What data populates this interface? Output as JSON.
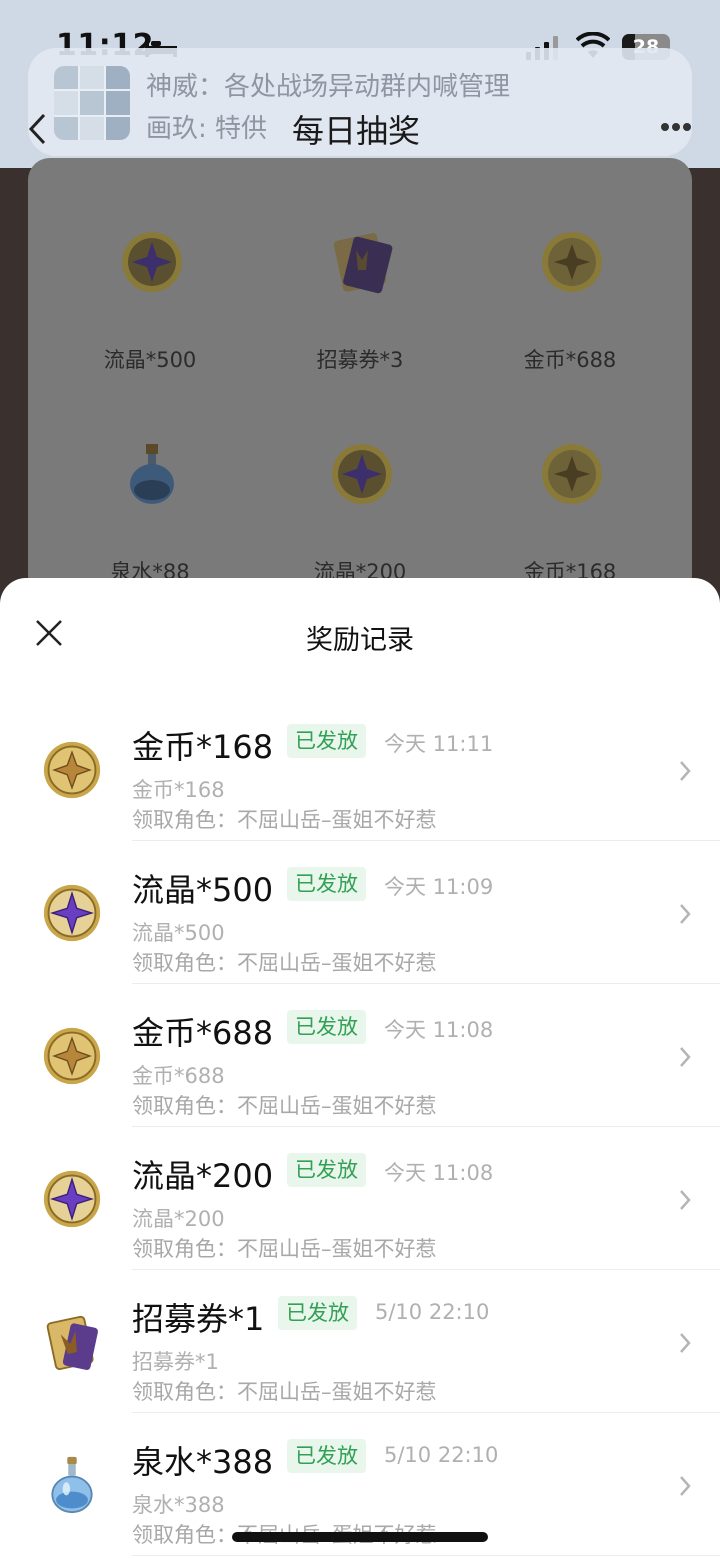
{
  "status": {
    "time": "11:12",
    "battery": "28",
    "battery_level": 0.28
  },
  "header": {
    "notif_line1": "神威：各处战场异动群内喊管理",
    "notif_line2": "画玖: 特供",
    "title": "每日抽奖"
  },
  "prizes": [
    {
      "icon": "crystal-coin-icon",
      "label": "流晶*500"
    },
    {
      "icon": "recruit-ticket-icon",
      "label": "招募券*3"
    },
    {
      "icon": "gold-coin-icon",
      "label": "金币*688"
    },
    {
      "icon": "potion-bottle-icon",
      "label": "泉水*88"
    },
    {
      "icon": "crystal-coin-icon",
      "label": "流晶*200"
    },
    {
      "icon": "gold-coin-icon",
      "label": "金币*168"
    }
  ],
  "sheet": {
    "title": "奖励记录",
    "records": [
      {
        "icon": "gold-coin-icon",
        "title": "金币*168",
        "status": "已发放",
        "time": "今天 11:11",
        "sub": "金币*168",
        "role": "领取角色：不屈山岳–蛋姐不好惹"
      },
      {
        "icon": "crystal-coin-icon",
        "title": "流晶*500",
        "status": "已发放",
        "time": "今天 11:09",
        "sub": "流晶*500",
        "role": "领取角色：不屈山岳–蛋姐不好惹"
      },
      {
        "icon": "gold-coin-icon",
        "title": "金币*688",
        "status": "已发放",
        "time": "今天 11:08",
        "sub": "金币*688",
        "role": "领取角色：不屈山岳–蛋姐不好惹"
      },
      {
        "icon": "crystal-coin-icon",
        "title": "流晶*200",
        "status": "已发放",
        "time": "今天 11:08",
        "sub": "流晶*200",
        "role": "领取角色：不屈山岳–蛋姐不好惹"
      },
      {
        "icon": "recruit-ticket-icon",
        "title": "招募券*1",
        "status": "已发放",
        "time": "5/10 22:10",
        "sub": "招募券*1",
        "role": "领取角色：不屈山岳–蛋姐不好惹"
      },
      {
        "icon": "potion-bottle-icon",
        "title": "泉水*388",
        "status": "已发放",
        "time": "5/10 22:10",
        "sub": "泉水*388",
        "role": "领取角色：不屈山岳–蛋姐不好惹"
      }
    ]
  },
  "colors": {
    "badge_green": "#33a055",
    "badge_bg": "#e8f6ec",
    "header_bg": "#cfd9e6"
  }
}
